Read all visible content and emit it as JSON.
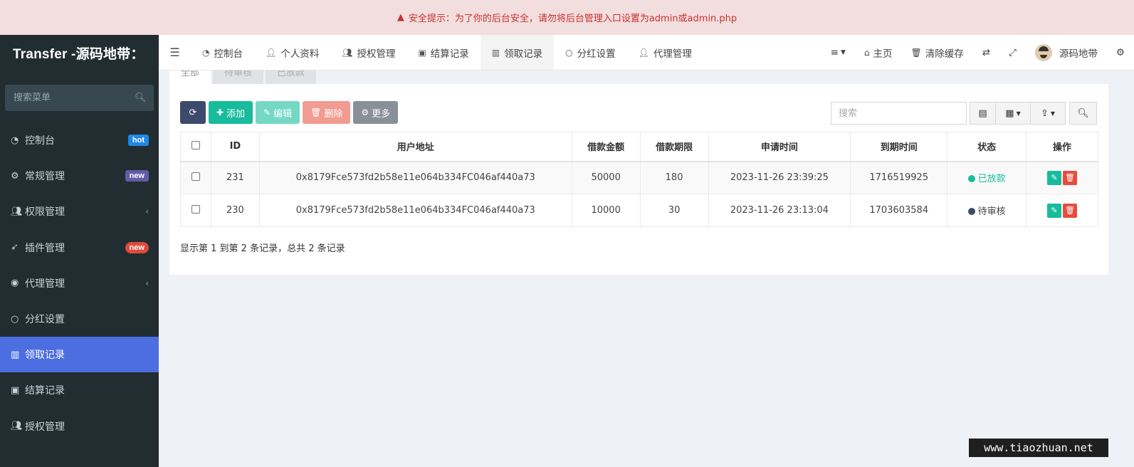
{
  "alert": {
    "icon": "warning-icon",
    "text": "安全提示：为了你的后台安全，请勿将后台管理入口设置为admin或admin.php"
  },
  "sidebar": {
    "brand": "Transfer -源码地带：",
    "search_placeholder": "搜索菜单",
    "items": [
      {
        "label": "控制台",
        "icon": "dashboard-icon",
        "badge": "hot"
      },
      {
        "label": "常规管理",
        "icon": "cogs-icon",
        "badge": "new"
      },
      {
        "label": "权限管理",
        "icon": "users-icon",
        "chevron": "‹"
      },
      {
        "label": "插件管理",
        "icon": "rocket-icon",
        "badge": "new"
      },
      {
        "label": "代理管理",
        "icon": "user-circle-icon",
        "chevron": "‹"
      },
      {
        "label": "分红设置",
        "icon": "circle-icon"
      },
      {
        "label": "领取记录",
        "icon": "bars-icon",
        "active": true
      },
      {
        "label": "结算记录",
        "icon": "cc-icon"
      },
      {
        "label": "授权管理",
        "icon": "users-icon"
      }
    ]
  },
  "topnav": {
    "items": [
      {
        "label": "控制台",
        "icon": "dashboard-icon"
      },
      {
        "label": "个人资料",
        "icon": "user-icon"
      },
      {
        "label": "授权管理",
        "icon": "users-icon"
      },
      {
        "label": "结算记录",
        "icon": "cc-icon"
      },
      {
        "label": "领取记录",
        "icon": "bars-icon",
        "active": true
      },
      {
        "label": "分红设置",
        "icon": "circle-icon"
      },
      {
        "label": "代理管理",
        "icon": "user-icon"
      }
    ],
    "right": {
      "home": "主页",
      "clear_cache": "清除缓存",
      "username": "源码地带"
    }
  },
  "tabs": [
    "全部",
    "待审核",
    "已放款"
  ],
  "toolbar": {
    "add": "添加",
    "edit": "编辑",
    "delete": "删除",
    "more": "更多",
    "search_placeholder": "搜索"
  },
  "table": {
    "columns": [
      "ID",
      "用户地址",
      "借款金额",
      "借款期限",
      "申请时间",
      "到期时间",
      "状态",
      "操作"
    ],
    "rows": [
      {
        "id": "231",
        "address": "0x8179Fce573fd2b58e11e064b334FC046af440a73",
        "amount": "50000",
        "term": "180",
        "apply_time": "2023-11-26 23:39:25",
        "due_time": "1716519925",
        "status": "已放款",
        "status_color": "#18bc9c"
      },
      {
        "id": "230",
        "address": "0x8179Fce573fd2b58e11e064b334FC046af440a73",
        "amount": "10000",
        "term": "30",
        "apply_time": "2023-11-26 23:13:04",
        "due_time": "1703603584",
        "status": "待审核",
        "status_color": "#3c4a6b"
      }
    ],
    "footer": "显示第 1 到第 2 条记录，总共 2 条记录"
  },
  "watermark": "www.tiaozhuan.net"
}
